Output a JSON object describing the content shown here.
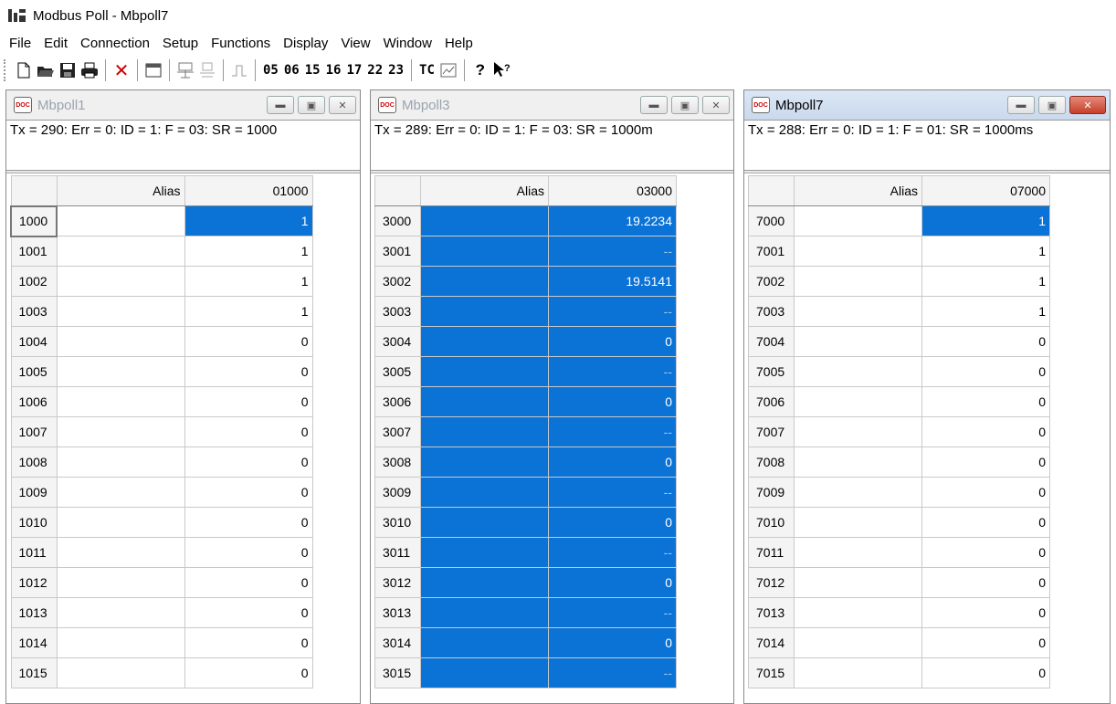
{
  "app": {
    "title": "Modbus Poll - Mbpoll7"
  },
  "menu": [
    "File",
    "Edit",
    "Connection",
    "Setup",
    "Functions",
    "Display",
    "View",
    "Window",
    "Help"
  ],
  "toolbar": {
    "codes": [
      "05",
      "06",
      "15",
      "16",
      "17",
      "22",
      "23"
    ],
    "tc_label": "TC"
  },
  "windows": [
    {
      "name": "Mbpoll1",
      "status": "Tx = 290: Err = 0: ID = 1: F = 03: SR = 1000",
      "alias_header": "Alias",
      "value_header": "01000",
      "rows": [
        {
          "addr": "1000",
          "value": "1"
        },
        {
          "addr": "1001",
          "value": "1"
        },
        {
          "addr": "1002",
          "value": "1"
        },
        {
          "addr": "1003",
          "value": "1"
        },
        {
          "addr": "1004",
          "value": "0"
        },
        {
          "addr": "1005",
          "value": "0"
        },
        {
          "addr": "1006",
          "value": "0"
        },
        {
          "addr": "1007",
          "value": "0"
        },
        {
          "addr": "1008",
          "value": "0"
        },
        {
          "addr": "1009",
          "value": "0"
        },
        {
          "addr": "1010",
          "value": "0"
        },
        {
          "addr": "1011",
          "value": "0"
        },
        {
          "addr": "1012",
          "value": "0"
        },
        {
          "addr": "1013",
          "value": "0"
        },
        {
          "addr": "1014",
          "value": "0"
        },
        {
          "addr": "1015",
          "value": "0"
        }
      ]
    },
    {
      "name": "Mbpoll3",
      "status": "Tx = 289: Err = 0: ID = 1: F = 03: SR = 1000m",
      "alias_header": "Alias",
      "value_header": "03000",
      "rows": [
        {
          "addr": "3000",
          "value": "19.2234"
        },
        {
          "addr": "3001",
          "value": "--"
        },
        {
          "addr": "3002",
          "value": "19.5141"
        },
        {
          "addr": "3003",
          "value": "--"
        },
        {
          "addr": "3004",
          "value": "0"
        },
        {
          "addr": "3005",
          "value": "--"
        },
        {
          "addr": "3006",
          "value": "0"
        },
        {
          "addr": "3007",
          "value": "--"
        },
        {
          "addr": "3008",
          "value": "0"
        },
        {
          "addr": "3009",
          "value": "--"
        },
        {
          "addr": "3010",
          "value": "0"
        },
        {
          "addr": "3011",
          "value": "--"
        },
        {
          "addr": "3012",
          "value": "0"
        },
        {
          "addr": "3013",
          "value": "--"
        },
        {
          "addr": "3014",
          "value": "0"
        },
        {
          "addr": "3015",
          "value": "--"
        }
      ]
    },
    {
      "name": "Mbpoll7",
      "status": "Tx = 288: Err = 0: ID = 1: F = 01: SR = 1000ms",
      "alias_header": "Alias",
      "value_header": "07000",
      "rows": [
        {
          "addr": "7000",
          "value": "1"
        },
        {
          "addr": "7001",
          "value": "1"
        },
        {
          "addr": "7002",
          "value": "1"
        },
        {
          "addr": "7003",
          "value": "1"
        },
        {
          "addr": "7004",
          "value": "0"
        },
        {
          "addr": "7005",
          "value": "0"
        },
        {
          "addr": "7006",
          "value": "0"
        },
        {
          "addr": "7007",
          "value": "0"
        },
        {
          "addr": "7008",
          "value": "0"
        },
        {
          "addr": "7009",
          "value": "0"
        },
        {
          "addr": "7010",
          "value": "0"
        },
        {
          "addr": "7011",
          "value": "0"
        },
        {
          "addr": "7012",
          "value": "0"
        },
        {
          "addr": "7013",
          "value": "0"
        },
        {
          "addr": "7014",
          "value": "0"
        },
        {
          "addr": "7015",
          "value": "0"
        }
      ]
    }
  ],
  "colors": {
    "selection": "#0b72d6",
    "active_title": "#cad9ec",
    "close_button": "#c6402b"
  }
}
